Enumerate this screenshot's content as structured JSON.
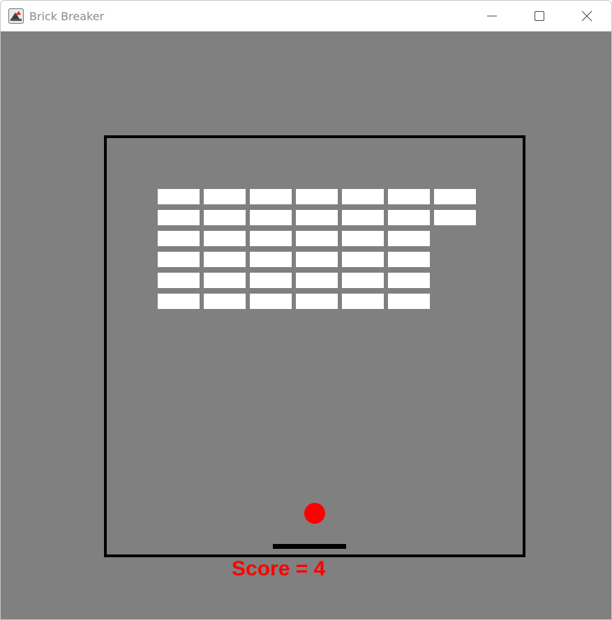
{
  "window": {
    "title": "Brick Breaker",
    "icons": {
      "app": "java-coffee-icon",
      "minimize": "minimize-icon",
      "maximize": "maximize-icon",
      "close": "close-icon"
    }
  },
  "game": {
    "colors": {
      "background": "#808080",
      "border": "#000000",
      "brick": "#ffffff",
      "ball": "#ff0000",
      "paddle": "#000000",
      "score": "#ff0000"
    },
    "score_label": "Score = 4",
    "bricks": [
      [
        1,
        1,
        1,
        1,
        1,
        1,
        1
      ],
      [
        1,
        1,
        1,
        1,
        1,
        1,
        1
      ],
      [
        1,
        1,
        1,
        1,
        1,
        1,
        0
      ],
      [
        1,
        1,
        1,
        1,
        1,
        1,
        0
      ],
      [
        1,
        1,
        1,
        1,
        1,
        1,
        0
      ],
      [
        1,
        1,
        1,
        1,
        1,
        1,
        0
      ]
    ]
  }
}
